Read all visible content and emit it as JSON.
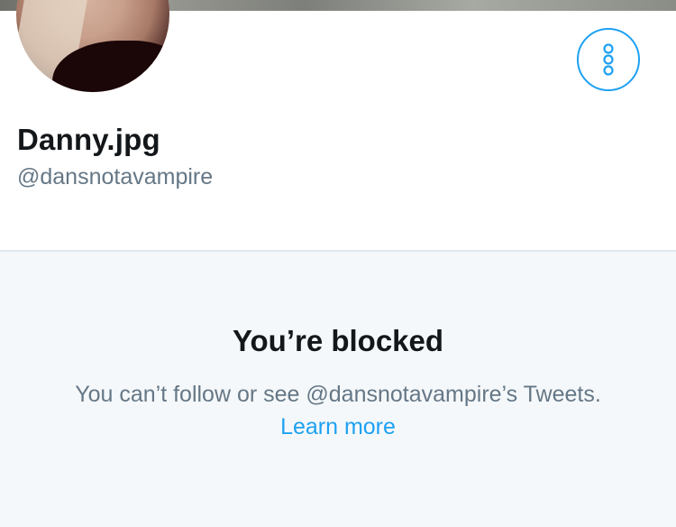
{
  "profile": {
    "display_name": "Danny.jpg",
    "handle": "@dansnotavampire"
  },
  "actions": {
    "more_icon": "vertical-ellipsis-icon"
  },
  "blocked": {
    "title": "You’re blocked",
    "description": "You can’t follow or see @dansnotavampire’s Tweets.",
    "learn_more": "Learn more"
  },
  "colors": {
    "accent": "#1da1f2",
    "text_primary": "#14171a",
    "text_secondary": "#657786",
    "panel_background": "#f5f8fa"
  }
}
